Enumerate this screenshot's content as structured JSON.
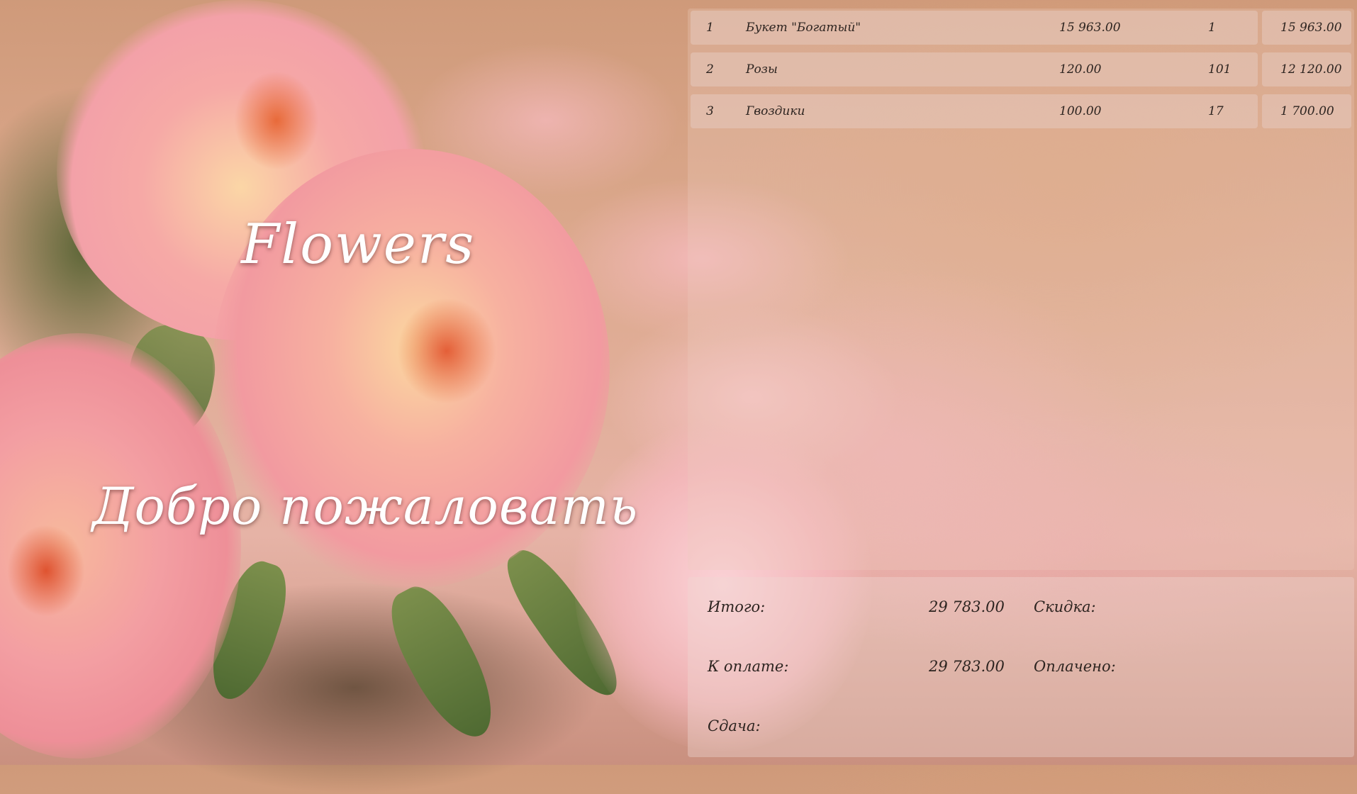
{
  "branding": {
    "title": "Flowers",
    "welcome": "Добро пожаловать"
  },
  "order": {
    "rows": [
      {
        "no": "1",
        "name": "Букет \"Богатый\"",
        "price": "15 963.00",
        "qty": "1",
        "total": "15 963.00"
      },
      {
        "no": "2",
        "name": "Розы",
        "price": "120.00",
        "qty": "101",
        "total": "12 120.00"
      },
      {
        "no": "3",
        "name": "Гвоздики",
        "price": "100.00",
        "qty": "17",
        "total": "1 700.00"
      }
    ]
  },
  "summary": {
    "total_label": "Итого:",
    "total_value": "29 783.00",
    "discount_label": "Скидка:",
    "to_pay_label": "К оплате:",
    "to_pay_value": "29 783.00",
    "paid_label": "Оплачено:",
    "change_label": "Сдача:"
  },
  "colors": {
    "text_dark": "#2d2420",
    "headline": "#ffffff"
  }
}
